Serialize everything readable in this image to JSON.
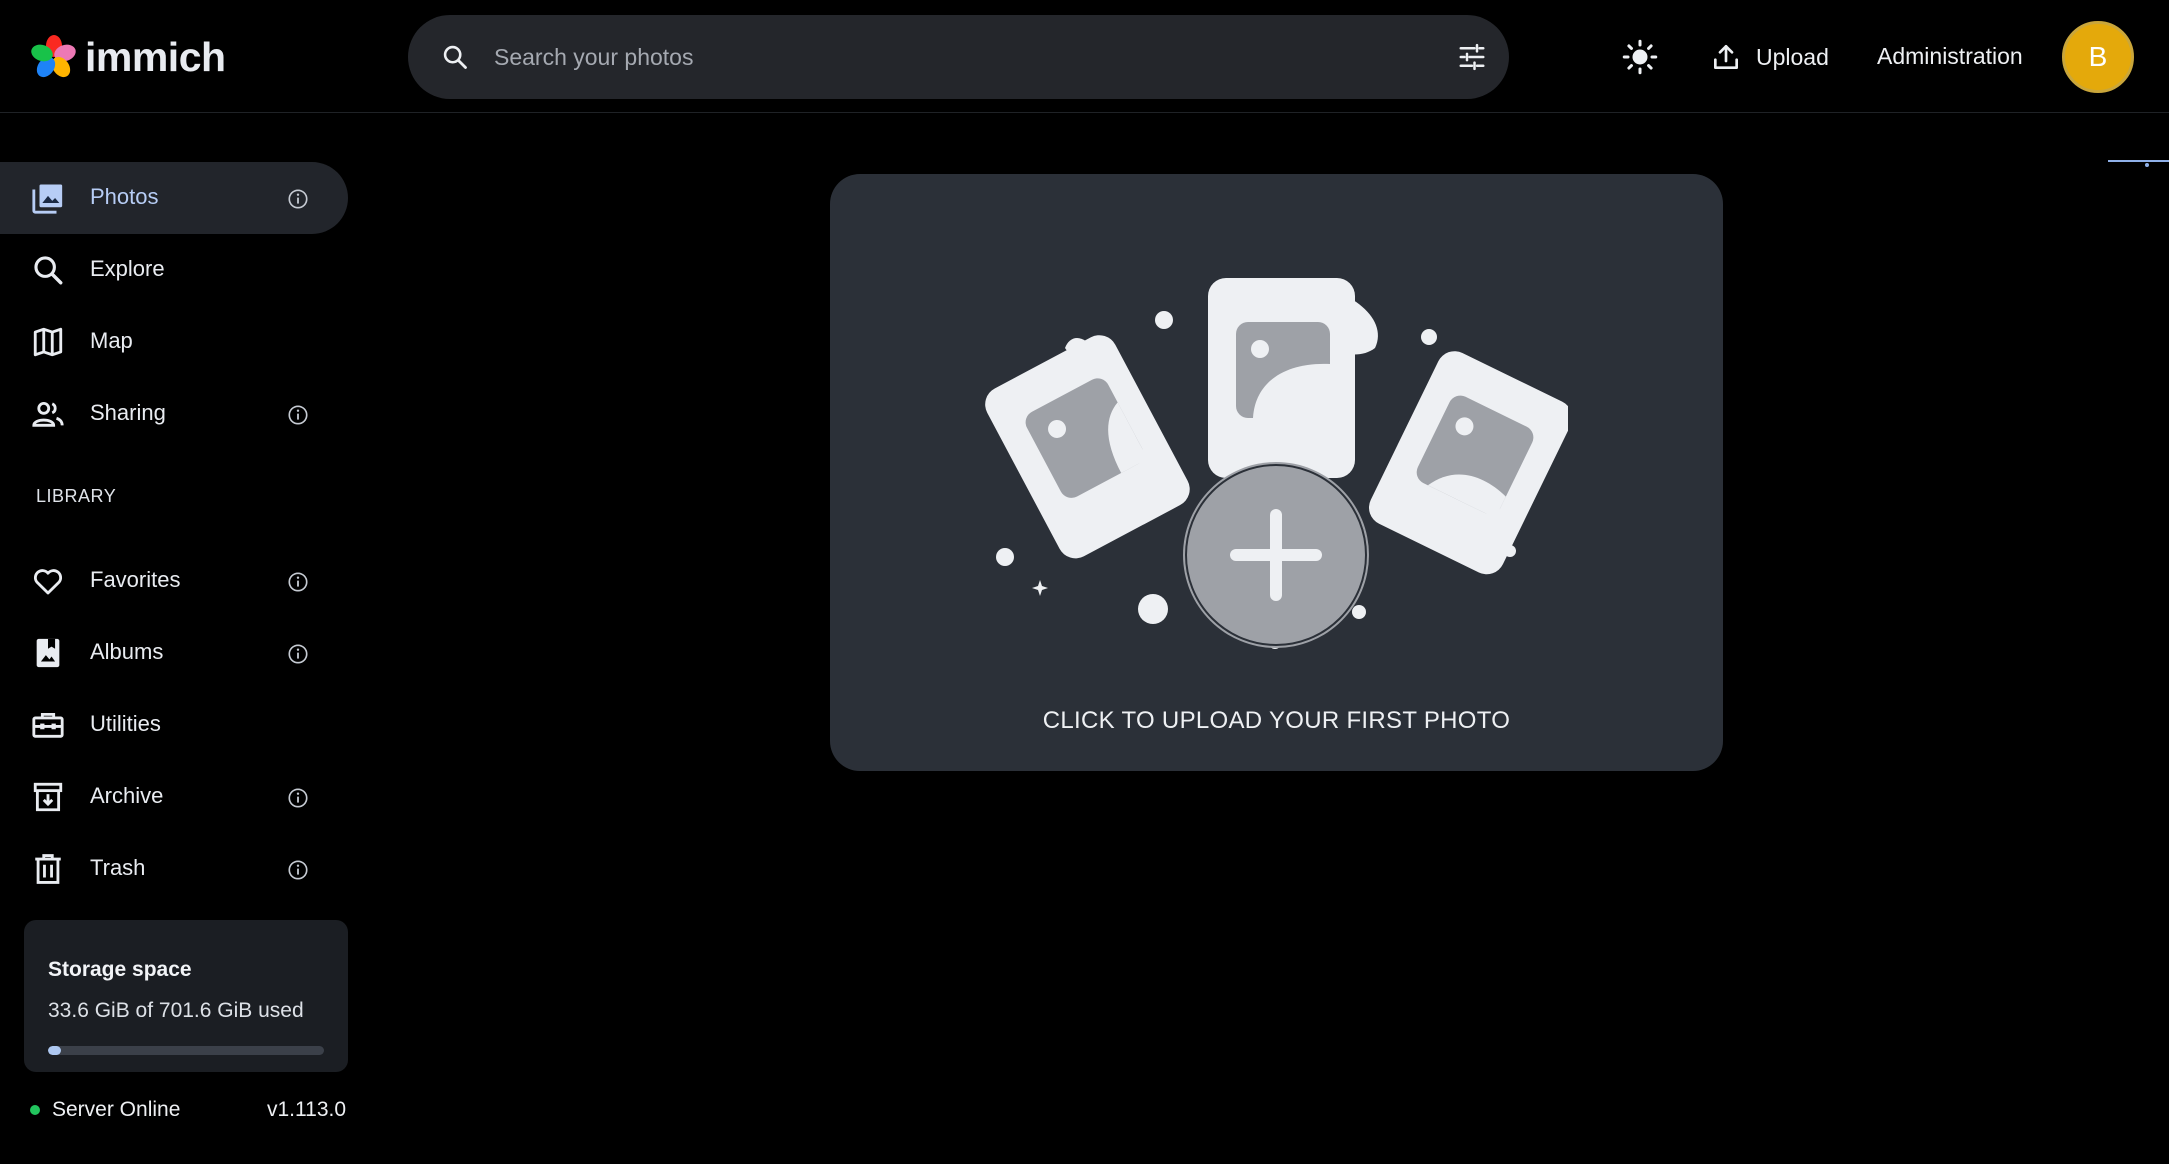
{
  "app": {
    "name": "immich"
  },
  "header": {
    "search_placeholder": "Search your photos",
    "upload_label": "Upload",
    "admin_label": "Administration",
    "avatar_initial": "B"
  },
  "sidebar": {
    "nav": [
      {
        "label": "Photos",
        "icon": "photos-icon",
        "active": true,
        "has_info": true
      },
      {
        "label": "Explore",
        "icon": "search-icon",
        "active": false,
        "has_info": false
      },
      {
        "label": "Map",
        "icon": "map-icon",
        "active": false,
        "has_info": false
      },
      {
        "label": "Sharing",
        "icon": "sharing-icon",
        "active": false,
        "has_info": true
      }
    ],
    "library_heading": "LIBRARY",
    "library": [
      {
        "label": "Favorites",
        "icon": "heart-icon",
        "has_info": true
      },
      {
        "label": "Albums",
        "icon": "album-icon",
        "has_info": true
      },
      {
        "label": "Utilities",
        "icon": "toolbox-icon",
        "has_info": false
      },
      {
        "label": "Archive",
        "icon": "archive-icon",
        "has_info": true
      },
      {
        "label": "Trash",
        "icon": "trash-icon",
        "has_info": true
      }
    ],
    "storage": {
      "title": "Storage space",
      "used_text": "33.6 GiB of 701.6 GiB used",
      "used_fraction": 0.048
    },
    "server": {
      "status": "Server Online",
      "version": "v1.113.0"
    }
  },
  "main": {
    "upload_prompt": "CLICK TO UPLOAD YOUR FIRST PHOTO"
  },
  "colors": {
    "background": "#000000",
    "accent": "#adc7f0",
    "avatar": "#e4a90b",
    "card": "#2b3038",
    "status_online": "#22c55e"
  }
}
